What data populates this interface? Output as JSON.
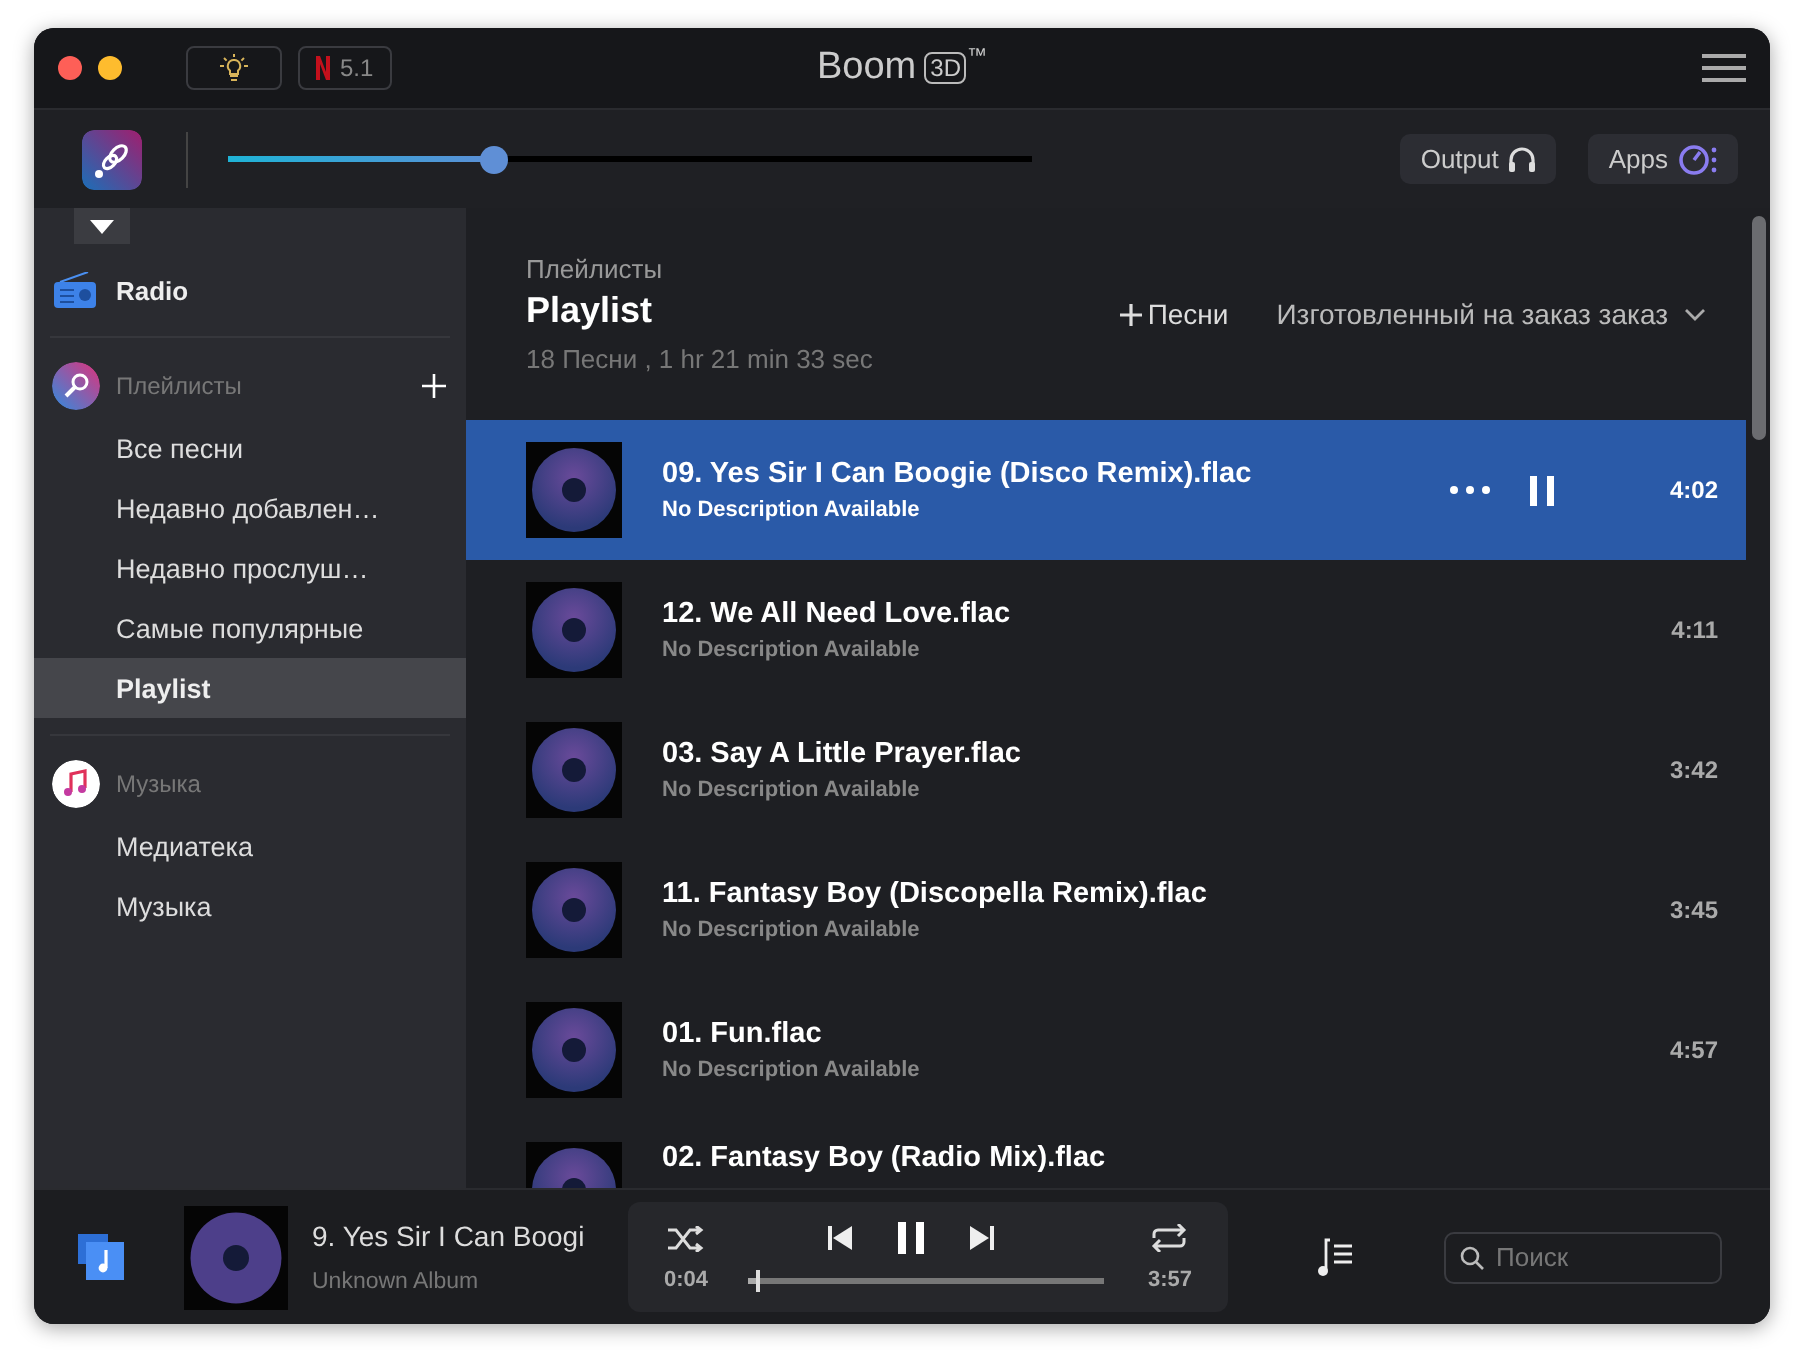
{
  "window": {
    "title": "Boom",
    "title_badge": "3D",
    "title_mark": "™"
  },
  "titlebar": {
    "badge": "5.1"
  },
  "toolbar": {
    "volume": {
      "level": 0.33
    },
    "buttons": [
      {
        "label": "Output",
        "kind": "output"
      },
      {
        "label": "Apps",
        "kind": "apps"
      }
    ]
  },
  "sidebar": {
    "collapse_tab": {
      "expanded": true
    },
    "radio": {
      "label": "Radio"
    },
    "sections": [
      {
        "title": "Плейлисты",
        "kind": "playlists",
        "addable": true,
        "items": [
          {
            "label": "Все песни",
            "selected": false
          },
          {
            "label": "Недавно добавлен…",
            "selected": false
          },
          {
            "label": "Недавно прослуш…",
            "selected": false
          },
          {
            "label": "Самые популярные",
            "selected": false
          },
          {
            "label": "Playlist",
            "selected": true
          }
        ]
      },
      {
        "title": "Музыка",
        "kind": "music",
        "addable": false,
        "items": [
          {
            "label": "Медиатека",
            "selected": false
          },
          {
            "label": "Музыка",
            "selected": false
          }
        ]
      }
    ]
  },
  "header": {
    "breadcrumb": "Плейлисты",
    "title": "Playlist",
    "summary": "18 Песни , 1 hr 21 min 33 sec",
    "add_songs": "Песни",
    "sort": "Изготовленный на заказ заказ"
  },
  "tracks": [
    {
      "title": "09. Yes Sir I Can Boogie (Disco Remix).flac",
      "description": "No Description Available",
      "duration": "4:02",
      "selected": true
    },
    {
      "title": "12. We All Need Love.flac",
      "description": "No Description Available",
      "duration": "4:11",
      "selected": false
    },
    {
      "title": "03. Say A Little Prayer.flac",
      "description": "No Description Available",
      "duration": "3:42",
      "selected": false
    },
    {
      "title": "11. Fantasy Boy (Discopella Remix).flac",
      "description": "No Description Available",
      "duration": "3:45",
      "selected": false
    },
    {
      "title": "01. Fun.flac",
      "description": "No Description Available",
      "duration": "4:57",
      "selected": false
    },
    {
      "title": "02. Fantasy Boy (Radio Mix).flac",
      "selected": false
    }
  ],
  "player": {
    "title": "9. Yes Sir I Can Boogi",
    "album": "Unknown Album",
    "elapsed": "0:04",
    "total": "3:57",
    "progress": {
      "level": 0.02
    },
    "search_placeholder": "Поиск"
  }
}
